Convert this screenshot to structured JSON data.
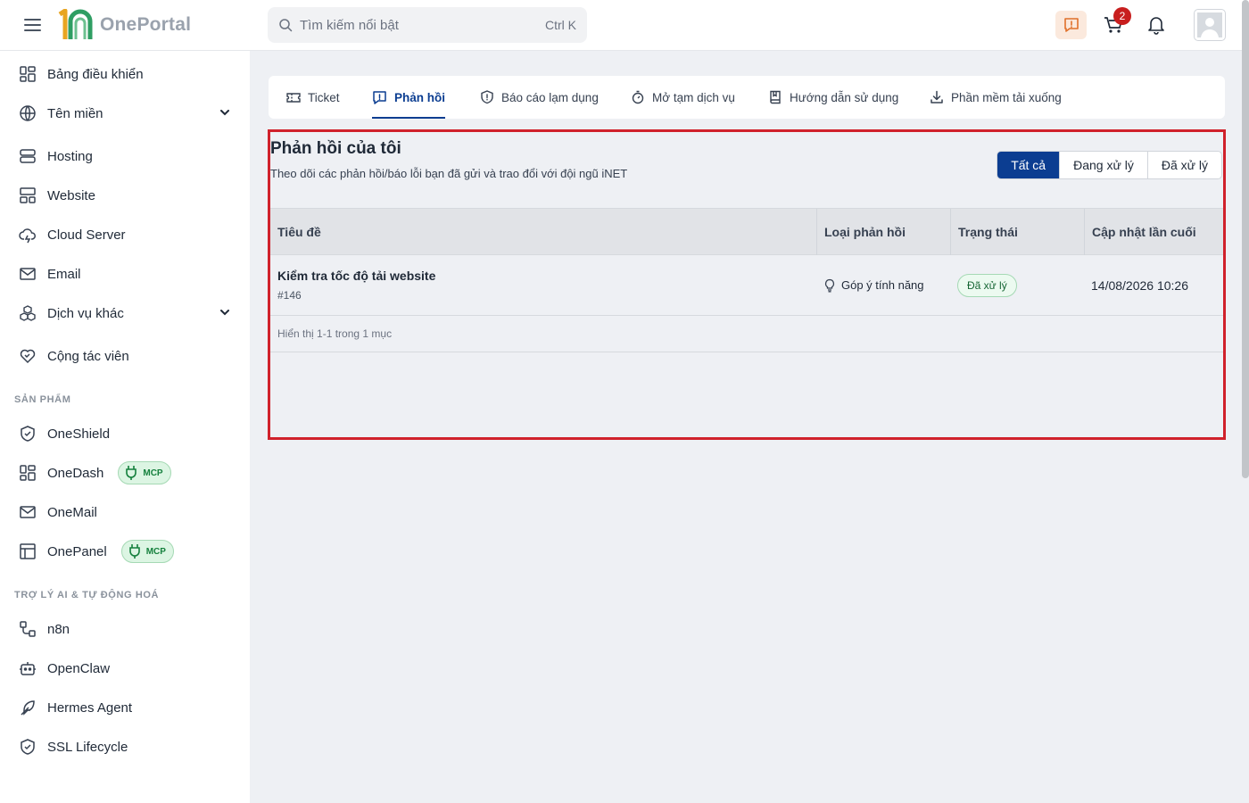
{
  "app": {
    "name": "OnePortal"
  },
  "header": {
    "search_placeholder": "Tìm kiếm nổi bật",
    "search_shortcut": "Ctrl K",
    "cart_count": "2"
  },
  "sidebar": {
    "items": [
      {
        "label": "Bảng điều khiển",
        "icon": "dashboard-icon"
      },
      {
        "label": "Tên miền",
        "icon": "globe-icon",
        "expandable": true
      },
      {
        "label": "Hosting",
        "icon": "server-icon"
      },
      {
        "label": "Website",
        "icon": "layout-icon"
      },
      {
        "label": "Cloud Server",
        "icon": "cloud-icon"
      },
      {
        "label": "Email",
        "icon": "mail-icon"
      },
      {
        "label": "Dịch vụ khác",
        "icon": "boxes-icon",
        "expandable": true
      },
      {
        "label": "Cộng tác viên",
        "icon": "handshake-heart-icon"
      }
    ],
    "sections": [
      {
        "title": "SẢN PHẨM",
        "items": [
          {
            "label": "OneShield",
            "icon": "shield-icon"
          },
          {
            "label": "OneDash",
            "icon": "dashboard-icon",
            "badge": "MCP"
          },
          {
            "label": "OneMail",
            "icon": "mail-icon"
          },
          {
            "label": "OnePanel",
            "icon": "panel-icon",
            "badge": "MCP"
          }
        ]
      },
      {
        "title": "TRỢ LÝ AI & TỰ ĐỘNG HOÁ",
        "items": [
          {
            "label": "n8n",
            "icon": "workflow-icon"
          },
          {
            "label": "OpenClaw",
            "icon": "bot-icon"
          },
          {
            "label": "Hermes Agent",
            "icon": "feather-icon"
          },
          {
            "label": "SSL Lifecycle",
            "icon": "shield-check-icon"
          }
        ]
      }
    ]
  },
  "tabs": [
    {
      "label": "Ticket",
      "icon": "ticket-icon",
      "active": false
    },
    {
      "label": "Phản hồi",
      "icon": "feedback-icon",
      "active": true
    },
    {
      "label": "Báo cáo lạm dụng",
      "icon": "shield-alert-icon",
      "active": false
    },
    {
      "label": "Mở tạm dịch vụ",
      "icon": "timer-icon",
      "active": false
    },
    {
      "label": "Hướng dẫn sử dụng",
      "icon": "book-icon",
      "active": false
    },
    {
      "label": "Phần mềm tải xuống",
      "icon": "download-icon",
      "active": false
    }
  ],
  "feedback": {
    "title": "Phản hồi của tôi",
    "subtitle": "Theo dõi các phản hồi/báo lỗi bạn đã gửi và trao đổi với đội ngũ iNET",
    "filters": [
      {
        "label": "Tất cả",
        "active": true
      },
      {
        "label": "Đang xử lý",
        "active": false
      },
      {
        "label": "Đã xử lý",
        "active": false
      }
    ],
    "columns": [
      "Tiêu đề",
      "Loại phản hồi",
      "Trạng thái",
      "Cập nhật lần cuối"
    ],
    "rows": [
      {
        "title": "Kiểm tra tốc độ tải website",
        "id": "#146",
        "type": "Góp ý tính năng",
        "status": "Đã xử lý",
        "updated": "14/08/2026 10:26"
      }
    ],
    "pagination": "Hiển thị 1-1 trong 1 mục"
  },
  "colors": {
    "primary": "#0b3d91",
    "highlight_border": "#d0212b",
    "badge_green": "#15803d",
    "cart_badge": "#c81e1e",
    "feedback_button_bg": "#fbe9dd"
  }
}
